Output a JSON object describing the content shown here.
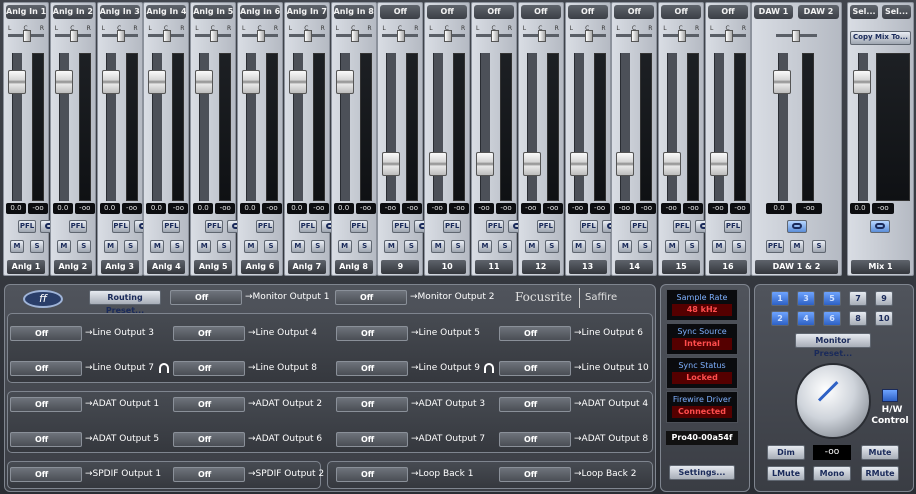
{
  "inputs": {
    "strips": [
      {
        "header": "Anlg In 1",
        "name": "Anlg 1",
        "left": "0.0",
        "right": "-oo",
        "fader": 0.86
      },
      {
        "header": "Anlg In 2",
        "name": "Anlg 2",
        "left": "0.0",
        "right": "-oo",
        "fader": 0.86
      },
      {
        "header": "Anlg In 3",
        "name": "Anlg 3",
        "left": "0.0",
        "right": "-oo",
        "fader": 0.86
      },
      {
        "header": "Anlg In 4",
        "name": "Anlg 4",
        "left": "0.0",
        "right": "-oo",
        "fader": 0.86
      },
      {
        "header": "Anlg In 5",
        "name": "Anlg 5",
        "left": "0.0",
        "right": "-oo",
        "fader": 0.86
      },
      {
        "header": "Anlg In 6",
        "name": "Anlg 6",
        "left": "0.0",
        "right": "-oo",
        "fader": 0.86
      },
      {
        "header": "Anlg In 7",
        "name": "Anlg 7",
        "left": "0.0",
        "right": "-oo",
        "fader": 0.86
      },
      {
        "header": "Anlg In 8",
        "name": "Anlg 8",
        "left": "0.0",
        "right": "-oo",
        "fader": 0.86
      },
      {
        "header": "Off",
        "name": "9",
        "left": "-oo",
        "right": "-oo",
        "fader": 0.2
      },
      {
        "header": "Off",
        "name": "10",
        "left": "-oo",
        "right": "-oo",
        "fader": 0.2
      },
      {
        "header": "Off",
        "name": "11",
        "left": "-oo",
        "right": "-oo",
        "fader": 0.2
      },
      {
        "header": "Off",
        "name": "12",
        "left": "-oo",
        "right": "-oo",
        "fader": 0.2
      },
      {
        "header": "Off",
        "name": "13",
        "left": "-oo",
        "right": "-oo",
        "fader": 0.2
      },
      {
        "header": "Off",
        "name": "14",
        "left": "-oo",
        "right": "-oo",
        "fader": 0.2
      },
      {
        "header": "Off",
        "name": "15",
        "left": "-oo",
        "right": "-oo",
        "fader": 0.2
      },
      {
        "header": "Off",
        "name": "16",
        "left": "-oo",
        "right": "-oo",
        "fader": 0.2
      }
    ],
    "pfl_label": "PFL",
    "mute_label": "M",
    "solo_label": "S",
    "pan_l": "L",
    "pan_c": "C",
    "pan_r": "R"
  },
  "daw": {
    "header1": "DAW 1",
    "header2": "DAW 2",
    "name": "DAW 1 & 2",
    "left": "0.0",
    "right": "-oo",
    "pfl_label": "PFL",
    "mute_label": "M",
    "solo_label": "S",
    "fader": 0.86
  },
  "mix": {
    "header1": "Sel...",
    "header2": "Sel...",
    "copy_label": "Copy Mix To...",
    "name": "Mix 1",
    "left": "0.0",
    "right": "-oo",
    "fader": 0.86
  },
  "routing": {
    "routing_preset_label": "Routing Preset...",
    "logo_text": "ff",
    "brand": "Focusrite",
    "product": "Saffire",
    "monitor": [
      {
        "value": "Off",
        "label": "Monitor Output 1"
      },
      {
        "value": "Off",
        "label": "Monitor Output 2"
      }
    ],
    "line": [
      {
        "value": "Off",
        "label": "Line Output 3"
      },
      {
        "value": "Off",
        "label": "Line Output 4"
      },
      {
        "value": "Off",
        "label": "Line Output 5"
      },
      {
        "value": "Off",
        "label": "Line Output 6"
      },
      {
        "value": "Off",
        "label": "Line Output 7"
      },
      {
        "value": "Off",
        "label": "Line Output 8"
      },
      {
        "value": "Off",
        "label": "Line Output 9"
      },
      {
        "value": "Off",
        "label": "Line Output 10"
      }
    ],
    "adat": [
      {
        "value": "Off",
        "label": "ADAT Output 1"
      },
      {
        "value": "Off",
        "label": "ADAT Output 2"
      },
      {
        "value": "Off",
        "label": "ADAT Output 3"
      },
      {
        "value": "Off",
        "label": "ADAT Output 4"
      },
      {
        "value": "Off",
        "label": "ADAT Output 5"
      },
      {
        "value": "Off",
        "label": "ADAT Output 6"
      },
      {
        "value": "Off",
        "label": "ADAT Output 7"
      },
      {
        "value": "Off",
        "label": "ADAT Output 8"
      }
    ],
    "spdif": [
      {
        "value": "Off",
        "label": "SPDIF Output 1"
      },
      {
        "value": "Off",
        "label": "SPDIF Output 2"
      }
    ],
    "loopback": [
      {
        "value": "Off",
        "label": "Loop Back 1"
      },
      {
        "value": "Off",
        "label": "Loop Back 2"
      }
    ],
    "arrow": "→"
  },
  "status": {
    "sample_rate_title": "Sample Rate",
    "sample_rate": "48 kHz",
    "sync_source_title": "Sync Source",
    "sync_source": "Internal",
    "sync_status_title": "Sync Status",
    "sync_status": "Locked",
    "driver_title": "Firewire Driver",
    "driver": "Connected",
    "device": "Pro40-00a54f",
    "settings_label": "Settings..."
  },
  "monitor": {
    "numbers": [
      [
        "1",
        "3",
        "5",
        "7",
        "9"
      ],
      [
        "2",
        "4",
        "6",
        "8",
        "10"
      ]
    ],
    "active": [
      "1",
      "2",
      "3",
      "4",
      "5",
      "6"
    ],
    "preset_label": "Monitor Preset...",
    "level": "-oo",
    "dim": "Dim",
    "mute": "Mute",
    "lmute": "LMute",
    "mono": "Mono",
    "rmute": "RMute",
    "hw_label": "H/W",
    "control_label": "Control"
  },
  "colors": {
    "accent": "#2e61c5",
    "status_red": "#ff4d4d",
    "status_title": "#7fb1ff"
  }
}
